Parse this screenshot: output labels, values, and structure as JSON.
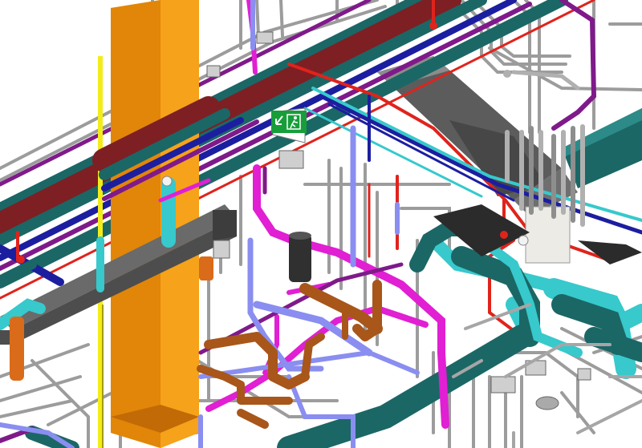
{
  "viewport": {
    "view_type": "3D isometric model view",
    "background_color": "#ffffff"
  },
  "model": {
    "systems": [
      {
        "name": "structural-column",
        "color": "#f59a0c"
      },
      {
        "name": "grey-duct",
        "color": "#6e6e6e"
      },
      {
        "name": "teal-duct",
        "color": "#1b6766"
      },
      {
        "name": "cyan-duct",
        "color": "#37c9cc"
      },
      {
        "name": "dark-red-pipe",
        "color": "#7e1f24"
      },
      {
        "name": "red-pipe",
        "color": "#e0231c"
      },
      {
        "name": "blue-pipe",
        "color": "#1c1ea0"
      },
      {
        "name": "magenta-pipe",
        "color": "#e11fd3"
      },
      {
        "name": "purple-pipe",
        "color": "#7f1a8a"
      },
      {
        "name": "lavender-pipe",
        "color": "#8a8ef0"
      },
      {
        "name": "grey-pipe",
        "color": "#9a9a9a"
      },
      {
        "name": "brown-drain-pipe",
        "color": "#a8561a"
      },
      {
        "name": "yellow-pipe",
        "color": "#f2ec1a"
      },
      {
        "name": "exit-sign",
        "color": "#179e3a"
      }
    ],
    "exit_sign": {
      "icon": "running-man-exit-icon",
      "arrow": "down-left-arrow-icon"
    }
  }
}
